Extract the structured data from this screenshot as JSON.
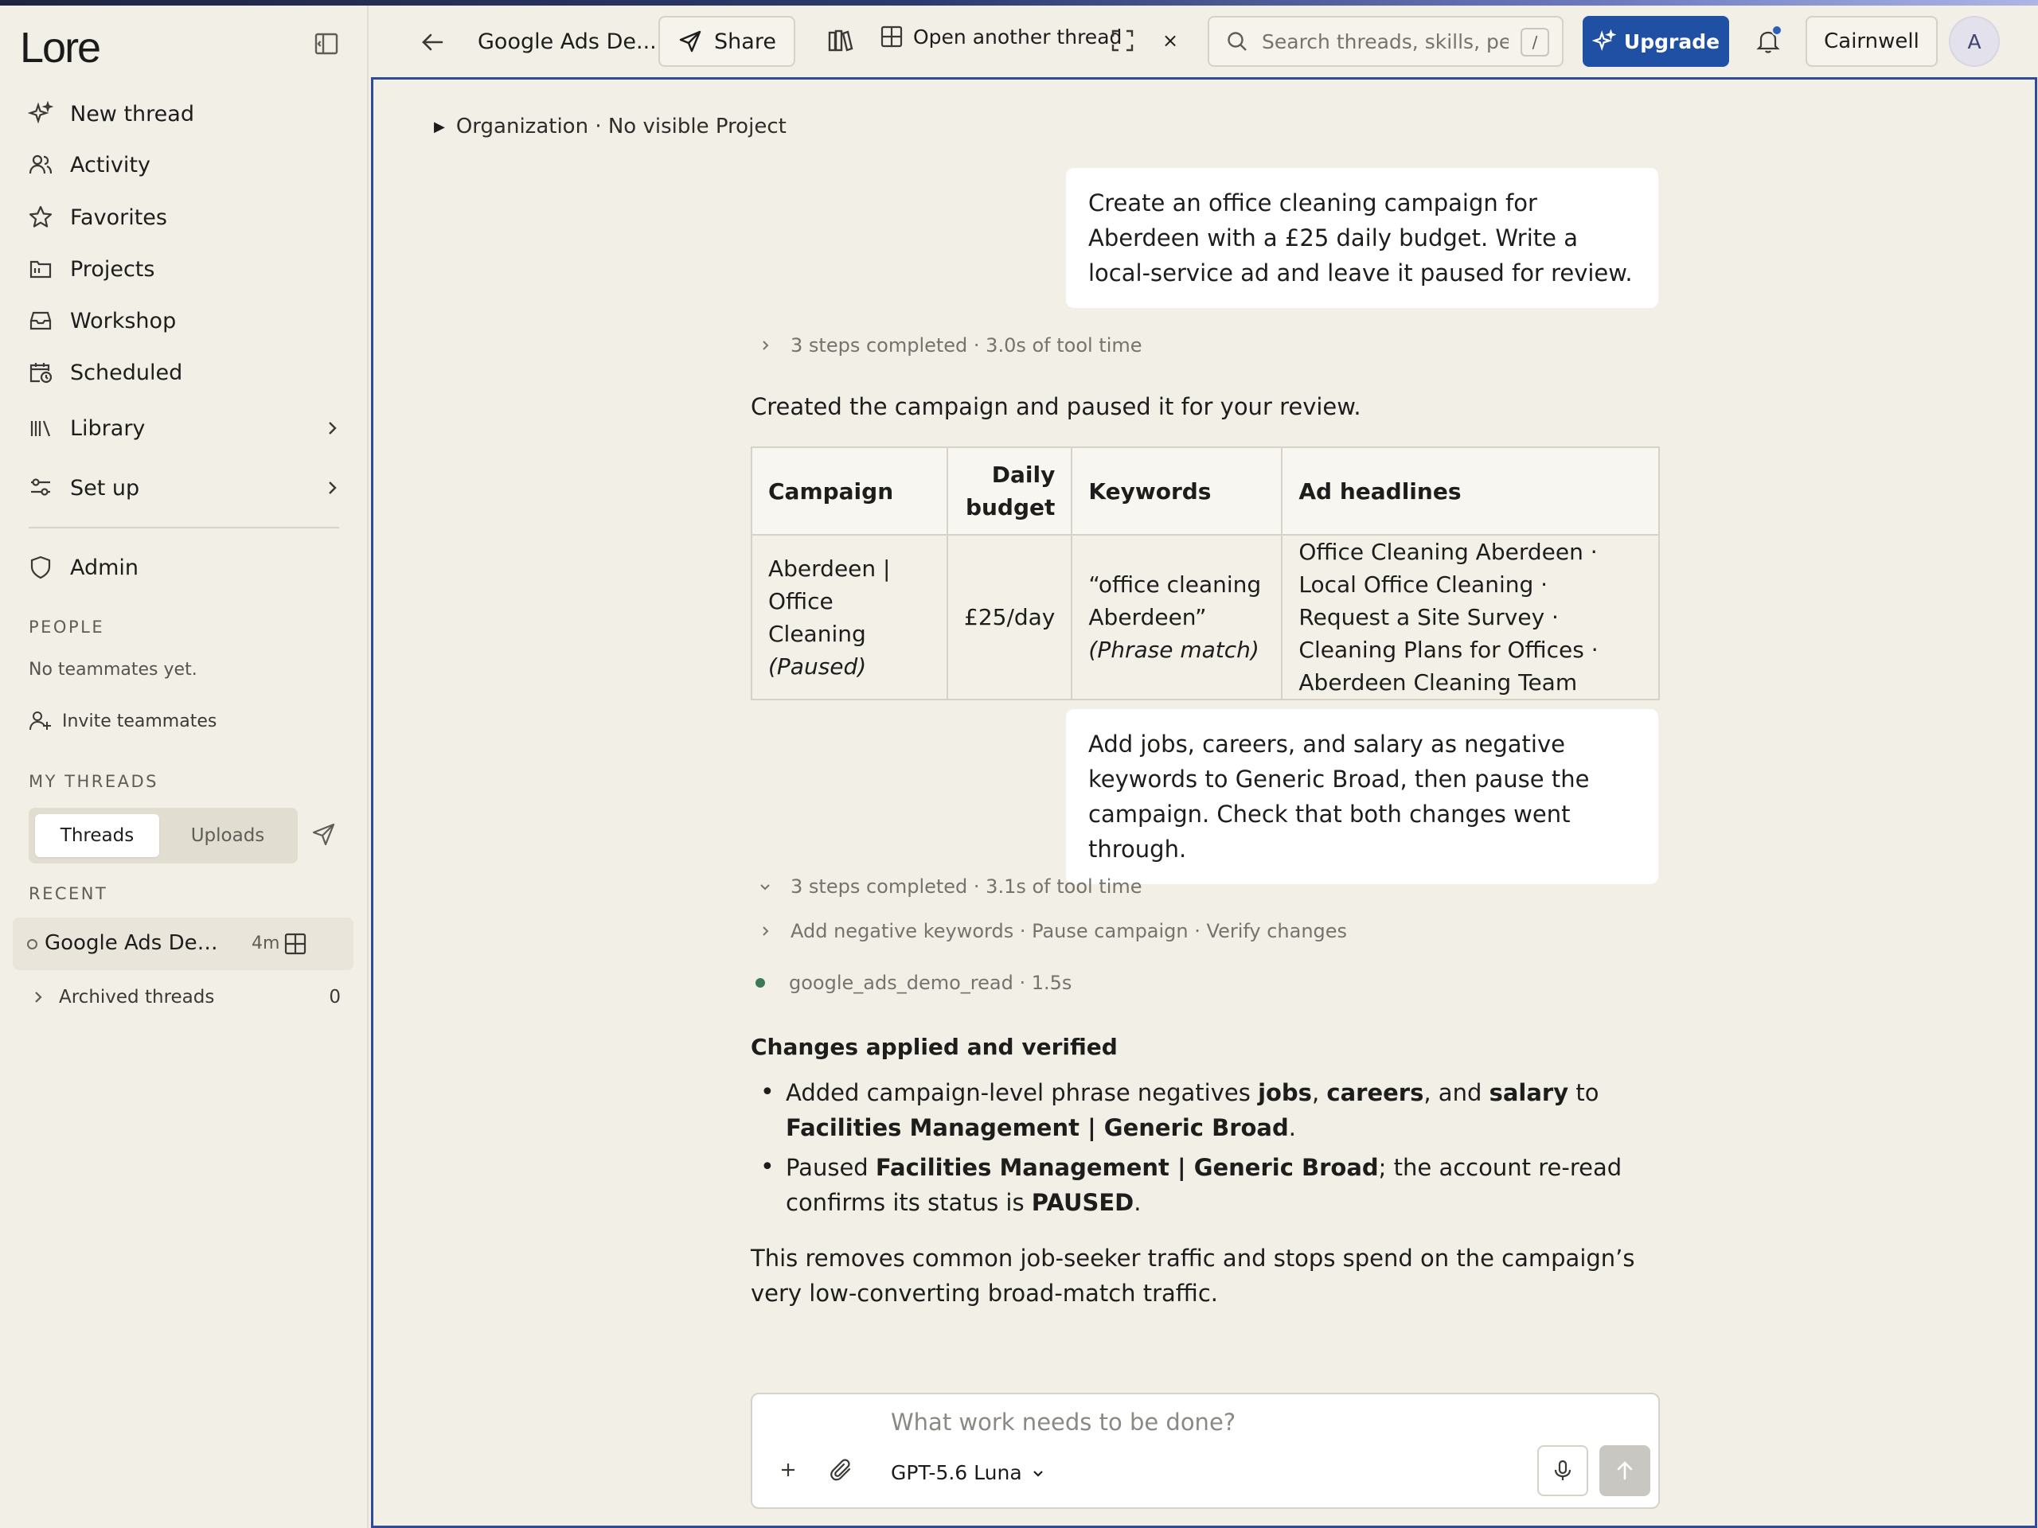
{
  "app": {
    "logo": "Lore"
  },
  "sidebar": {
    "nav": [
      {
        "label": "New thread",
        "icon": "sparkle-icon"
      },
      {
        "label": "Activity",
        "icon": "people-icon"
      },
      {
        "label": "Favorites",
        "icon": "star-icon"
      },
      {
        "label": "Projects",
        "icon": "folder-icon"
      },
      {
        "label": "Workshop",
        "icon": "inbox-icon"
      },
      {
        "label": "Scheduled",
        "icon": "calendar-clock-icon"
      },
      {
        "label": "Library",
        "icon": "library-icon"
      },
      {
        "label": "Set up",
        "icon": "sliders-icon"
      },
      {
        "label": "Admin",
        "icon": "shield-icon"
      }
    ],
    "people_label": "PEOPLE",
    "no_teammates": "No teammates yet.",
    "invite_label": "Invite teammates",
    "my_threads_label": "MY THREADS",
    "tabs": {
      "threads": "Threads",
      "uploads": "Uploads"
    },
    "recent_label": "RECENT",
    "recent_thread": {
      "title": "Google Ads Demo ...",
      "age": "4m"
    },
    "archived": {
      "label": "Archived threads",
      "count": "0"
    }
  },
  "header": {
    "thread_title": "Google Ads De...",
    "share_label": "Share",
    "open_thread_label": "Open another thread",
    "close_glyph": "×",
    "search_placeholder": "Search threads, skills, peop",
    "search_shortcut": "/",
    "upgrade_label": "Upgrade",
    "org_label": "Cairnwell",
    "avatar_initial": "A"
  },
  "thread": {
    "breadcrumb": "Organization · No visible Project",
    "msg1": "Create an office cleaning campaign for Aberdeen with a £25 daily budget. Write a local-service ad and leave it paused for review.",
    "steps1": "3 steps completed · 3.0s of tool time",
    "reply1": "Created the campaign and paused it for your review.",
    "table": {
      "headers": [
        "Campaign",
        "Daily budget",
        "Keywords",
        "Ad headlines"
      ],
      "row": {
        "campaign": "Aberdeen | Office Cleaning",
        "campaign_status": "(Paused)",
        "budget": "£25/day",
        "keyword": "“office cleaning Aberdeen”",
        "keyword_match": "(Phrase match)",
        "headlines": "Office Cleaning Aberdeen · Local Office Cleaning · Request a Site Survey · Cleaning Plans for Offices · Aberdeen Cleaning Team"
      }
    },
    "msg2": "Add jobs, careers, and salary as negative keywords to Generic Broad, then pause the campaign. Check that both changes went through.",
    "steps2": "3 steps completed · 3.1s of tool time",
    "substeps": "Add negative keywords · Pause campaign · Verify changes",
    "tool_call": "google_ads_demo_read · 1.5s",
    "heading": "Changes applied and verified",
    "bullet1": {
      "pre": "Added campaign-level phrase negatives ",
      "k1": "jobs",
      "sep1": ", ",
      "k2": "careers",
      "sep2": ", and ",
      "k3": "salary",
      "mid": " to ",
      "target": "Facilities Management | Generic Broad",
      "end": "."
    },
    "bullet2": {
      "pre": "Paused ",
      "target": "Facilities Management | Generic Broad",
      "mid": "; the account re-read confirms its status is ",
      "status": "PAUSED",
      "end": "."
    },
    "summary": "This removes common job-seeker traffic and stops spend on the campaign’s very low-converting broad-match traffic."
  },
  "composer": {
    "placeholder": "What work needs to be done?",
    "model": "GPT-5.6 Luna"
  },
  "colors": {
    "accent": "#2050a4",
    "focus_border": "#2f4a9a",
    "tool_dot": "#3c7a57"
  }
}
